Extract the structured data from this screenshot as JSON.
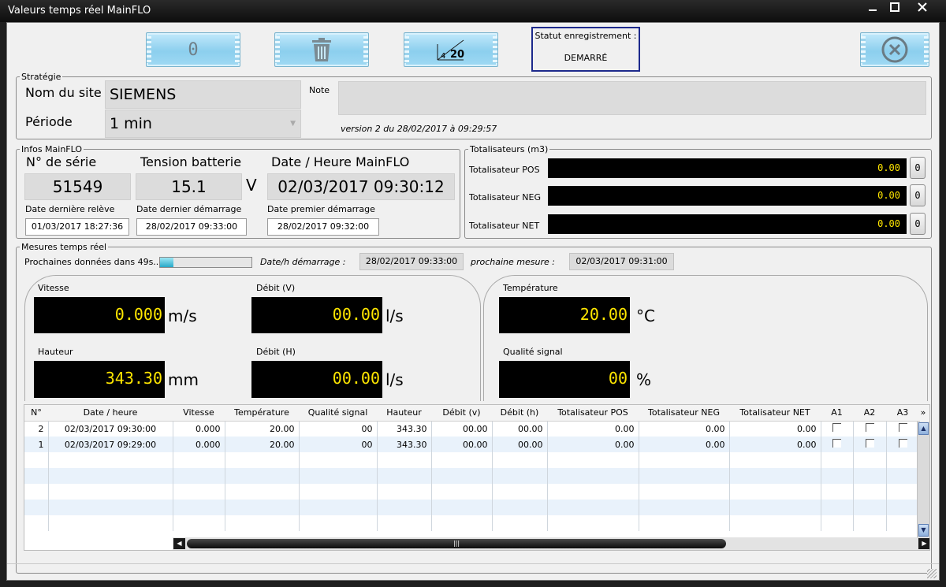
{
  "window": {
    "title": "Valeurs temps réel MainFLO",
    "controls": [
      "minimize",
      "maximize",
      "close"
    ]
  },
  "toolbar": {
    "reset_label": "0",
    "trash_icon": "trash-icon",
    "scale_label_small": "4",
    "scale_label_big": "20",
    "close_icon": "close-circle-icon",
    "status_label": "Statut enregistrement :",
    "status_value": "DEMARRÉ"
  },
  "strategy": {
    "legend": "Stratégie",
    "site_label": "Nom du site",
    "site_value": "SIEMENS",
    "period_label": "Période",
    "period_value": "1 min",
    "note_label": "Note",
    "note_value": "",
    "version": "version 2 du 28/02/2017 à 09:29:57"
  },
  "infos": {
    "legend": "Infos MainFLO",
    "serial_label": "N° de série",
    "serial_value": "51549",
    "battery_label": "Tension batterie",
    "battery_value": "15.1",
    "battery_unit": "V",
    "datetime_label": "Date / Heure MainFLO",
    "datetime_value": "02/03/2017 09:30:12",
    "last_read_label": "Date dernière relève",
    "last_read_value": "01/03/2017 18:27:36",
    "last_start_label": "Date dernier démarrage",
    "last_start_value": "28/02/2017 09:33:00",
    "first_start_label": "Date premier démarrage",
    "first_start_value": "28/02/2017 09:32:00"
  },
  "totalizers": {
    "legend": "Totalisateurs (m3)",
    "items": [
      {
        "label": "Totalisateur POS",
        "value": "0.00",
        "reset": "0"
      },
      {
        "label": "Totalisateur NEG",
        "value": "0.00",
        "reset": "0"
      },
      {
        "label": "Totalisateur NET",
        "value": "0.00",
        "reset": "0"
      }
    ]
  },
  "realtime": {
    "legend": "Mesures temps réel",
    "next_label": "Prochaines données dans 49s...",
    "progress": 0.15,
    "start_label": "Date/h démarrage :",
    "start_value": "28/02/2017 09:33:00",
    "next_measure_label": "prochaine mesure :",
    "next_measure_value": "02/03/2017 09:31:00",
    "vitesse": {
      "label": "Vitesse",
      "value": "0.000",
      "unit": "m/s"
    },
    "debit_v": {
      "label": "Débit (V)",
      "value": "00.00",
      "unit": "l/s"
    },
    "hauteur": {
      "label": "Hauteur",
      "value": "343.30",
      "unit": "mm"
    },
    "debit_h": {
      "label": "Débit (H)",
      "value": "00.00",
      "unit": "l/s"
    },
    "temperature": {
      "label": "Température",
      "value": "20.00",
      "unit": "°C"
    },
    "quality": {
      "label": "Qualité signal",
      "value": "00",
      "unit": "%"
    }
  },
  "table": {
    "headers": [
      "N°",
      "Date / heure",
      "Vitesse",
      "Température",
      "Qualité signal",
      "Hauteur",
      "Débit (v)",
      "Débit (h)",
      "Totalisateur POS",
      "Totalisateur NEG",
      "Totalisateur NET",
      "A1",
      "A2",
      "A3"
    ],
    "rows": [
      [
        "2",
        "02/03/2017 09:30:00",
        "0.000",
        "20.00",
        "00",
        "343.30",
        "00.00",
        "00.00",
        "0.00",
        "0.00",
        "0.00"
      ],
      [
        "1",
        "02/03/2017 09:29:00",
        "0.000",
        "20.00",
        "00",
        "343.30",
        "00.00",
        "00.00",
        "0.00",
        "0.00",
        "0.00"
      ]
    ]
  }
}
